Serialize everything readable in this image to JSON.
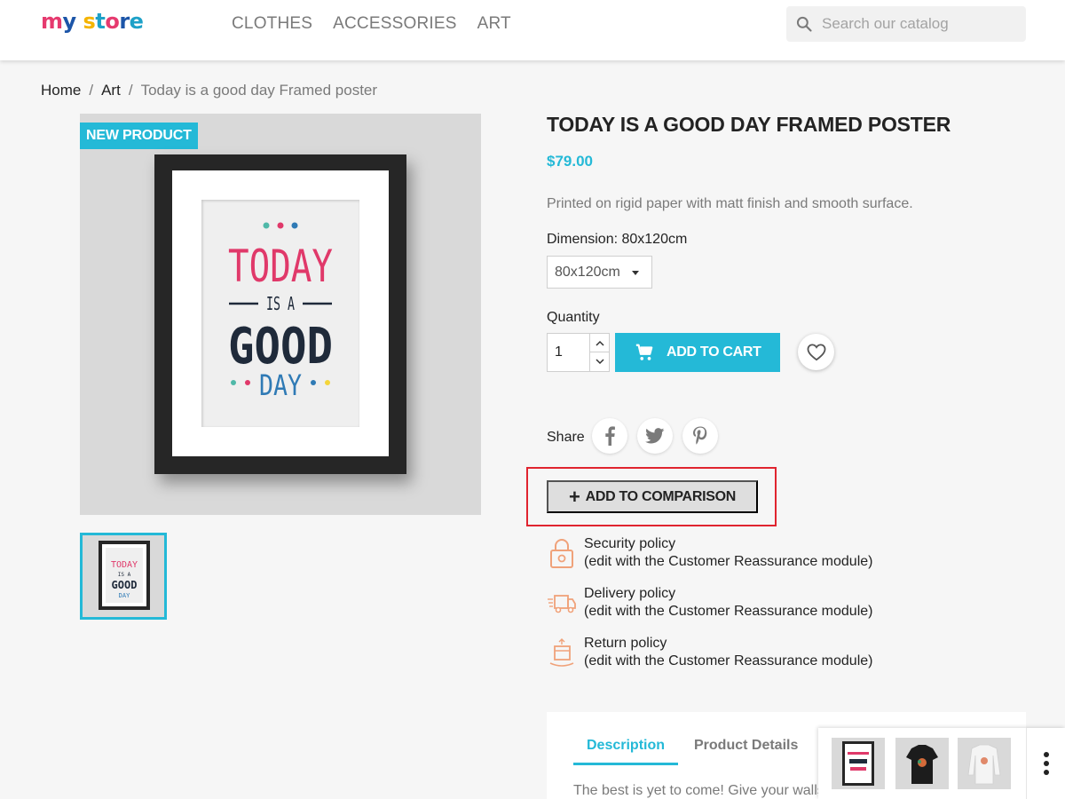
{
  "header": {
    "logo_text": "my store",
    "nav": [
      "CLOTHES",
      "ACCESSORIES",
      "ART"
    ],
    "search_placeholder": "Search our catalog"
  },
  "breadcrumb": [
    "Home",
    "Art",
    "Today is a good day Framed poster"
  ],
  "product": {
    "badge": "NEW PRODUCT",
    "title": "TODAY IS A GOOD DAY FRAMED POSTER",
    "price": "$79.00",
    "description": "Printed on rigid paper with matt finish and smooth surface.",
    "poster_lines": [
      "TODAY",
      "IS A",
      "GOOD",
      "DAY"
    ],
    "dimension_label": "Dimension: 80x120cm",
    "dimension_selected": "80x120cm",
    "quantity_label": "Quantity",
    "quantity_value": "1",
    "add_to_cart": "ADD TO CART",
    "share_label": "Share",
    "add_to_comparison": "ADD TO COMPARISON"
  },
  "reassurance": [
    {
      "title": "Security policy",
      "detail": "(edit with the Customer Reassurance module)",
      "icon": "lock-icon"
    },
    {
      "title": "Delivery policy",
      "detail": "(edit with the Customer Reassurance module)",
      "icon": "truck-icon"
    },
    {
      "title": "Return policy",
      "detail": "(edit with the Customer Reassurance module)",
      "icon": "return-box-icon"
    }
  ],
  "tabs": {
    "active": "Description",
    "inactive": "Product Details",
    "content_preview": "The best is yet to come! Give your walls"
  },
  "colors": {
    "accent": "#24b9d7",
    "highlight_border": "#e0242f",
    "poster_pink": "#e0396a",
    "poster_dark": "#1f2a3a",
    "poster_blue": "#2f7ab5"
  }
}
